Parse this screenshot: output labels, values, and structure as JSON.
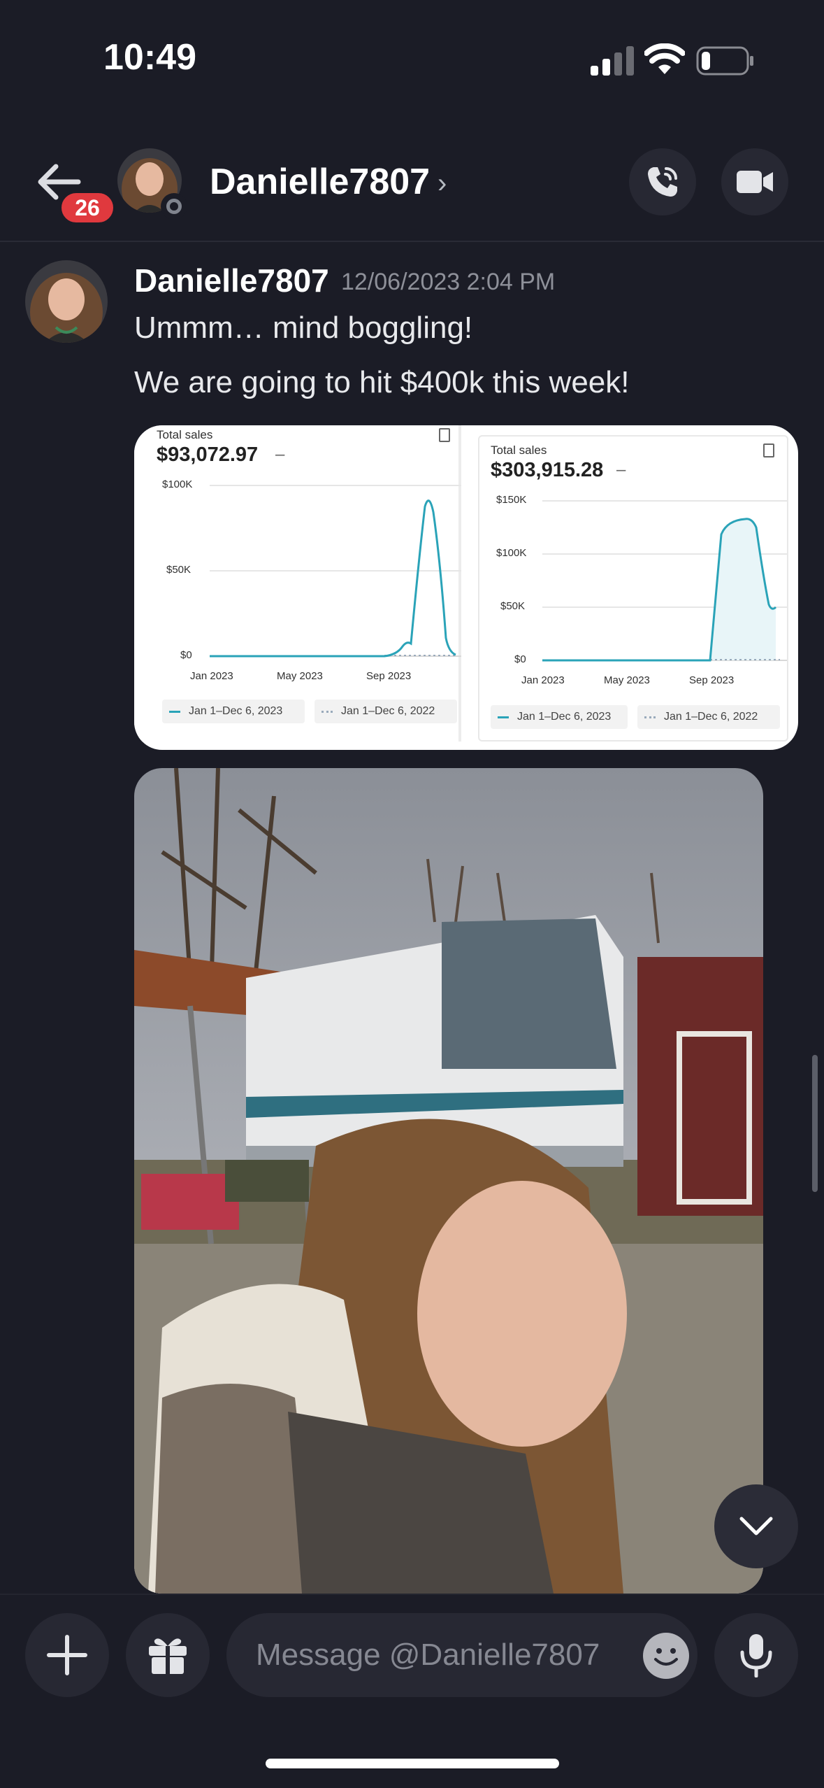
{
  "status_bar": {
    "time": "10:49"
  },
  "header": {
    "unread_badge": "26",
    "username": "Danielle7807",
    "chevron": "›"
  },
  "message": {
    "author": "Danielle7807",
    "timestamp": "12/06/2023 2:04 PM",
    "lines": [
      "Ummm… mind boggling!",
      "We are going to hit $400k this week!"
    ],
    "attachment_1": {
      "panels": [
        {
          "label": "Total sales",
          "amount": "$93,072.97",
          "dash": "–",
          "y_ticks": [
            "$100K",
            "$50K",
            "$0"
          ],
          "x_ticks": [
            "Jan 2023",
            "May 2023",
            "Sep 2023"
          ],
          "legend": [
            "Jan 1–Dec 6, 2023",
            "Jan 1–Dec 6, 2022"
          ]
        },
        {
          "label": "Total sales",
          "amount": "$303,915.28",
          "dash": "–",
          "y_ticks": [
            "$150K",
            "$100K",
            "$50K",
            "$0"
          ],
          "x_ticks": [
            "Jan 2023",
            "May 2023",
            "Sep 2023"
          ],
          "legend": [
            "Jan 1–Dec 6, 2023",
            "Jan 1–Dec 6, 2022"
          ]
        }
      ]
    },
    "attachment_2": {
      "type": "photo"
    }
  },
  "composer": {
    "placeholder": "Message @Danielle7807"
  },
  "colors": {
    "background": "#1b1c26",
    "badge": "#e0393e",
    "chart_line": "#2aa3b8"
  }
}
